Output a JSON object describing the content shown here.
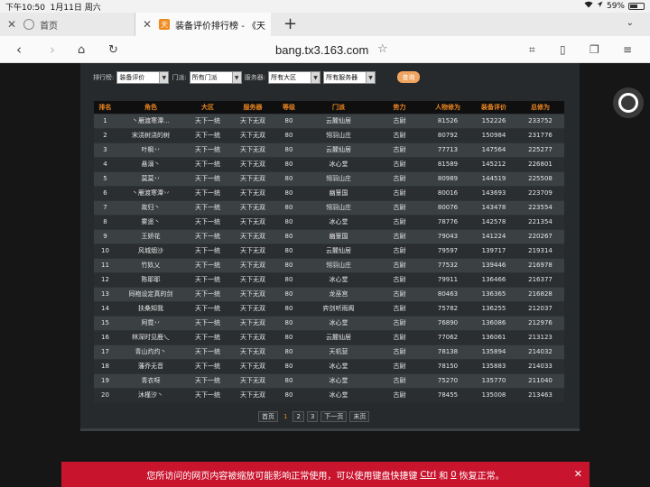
{
  "status": {
    "time": "下午10:50",
    "date": "1月11日 周六",
    "battery": "59%",
    "battery_level": 0.59,
    "icons": [
      "wifi-icon",
      "location-icon",
      "battery-icon"
    ]
  },
  "tabs": [
    {
      "title": "首页"
    },
    {
      "title": "装备评价排行榜 - 《天"
    }
  ],
  "toolbar": {
    "url": "bang.tx3.163.com"
  },
  "filters": {
    "rank_label": "排行榜:",
    "rank_value": "装备评价",
    "school_label": "门派:",
    "school_value": "所有门派",
    "server_label": "服务器:",
    "zone_value": "所有大区",
    "server_value": "所有服务器",
    "query_label": "查询"
  },
  "table": {
    "headers": [
      "排名",
      "角色",
      "大区",
      "服务器",
      "等级",
      "门派",
      "势力",
      "人物修为",
      "装备评价",
      "总修为"
    ],
    "rows": [
      [
        "1",
        "丶雁渡寒潭...",
        "天下一统",
        "天下无双",
        "80",
        "云麓仙居",
        "古尉",
        "81526",
        "152226",
        "233752"
      ],
      [
        "2",
        "宋浇树浇的树",
        "天下一统",
        "天下无双",
        "80",
        "翎羽山庄",
        "古尉",
        "80792",
        "150984",
        "231776"
      ],
      [
        "3",
        "叶枫丷",
        "天下一统",
        "天下无双",
        "80",
        "云麓仙居",
        "古尉",
        "77713",
        "147564",
        "225277"
      ],
      [
        "4",
        "悬溺丶",
        "天下一统",
        "天下无双",
        "80",
        "冰心堂",
        "古尉",
        "81589",
        "145212",
        "226801"
      ],
      [
        "5",
        "莫莫丷",
        "天下一统",
        "天下无双",
        "80",
        "翎羽山庄",
        "古尉",
        "80989",
        "144519",
        "225508"
      ],
      [
        "6",
        "丶雁渡寒潭丷",
        "天下一统",
        "天下无双",
        "80",
        "幽篁国",
        "古尉",
        "80016",
        "143693",
        "223709"
      ],
      [
        "7",
        "故归丶",
        "天下一统",
        "天下无双",
        "80",
        "翎羽山庄",
        "古尉",
        "80076",
        "143478",
        "223554"
      ],
      [
        "8",
        "雾遥丶",
        "天下一统",
        "天下无双",
        "80",
        "冰心堂",
        "古尉",
        "78776",
        "142578",
        "221354"
      ],
      [
        "9",
        "王娇花",
        "天下一统",
        "天下无双",
        "80",
        "幽篁国",
        "古尉",
        "79043",
        "141224",
        "220267"
      ],
      [
        "10",
        "风城烟沙",
        "天下一统",
        "天下无双",
        "80",
        "云麓仙居",
        "古尉",
        "79597",
        "139717",
        "219314"
      ],
      [
        "11",
        "竹奺乂",
        "天下一统",
        "天下无双",
        "80",
        "翎羽山庄",
        "古尉",
        "77532",
        "139446",
        "216978"
      ],
      [
        "12",
        "陈耶耶",
        "天下一统",
        "天下无双",
        "80",
        "冰心堂",
        "古尉",
        "79911",
        "136466",
        "216377"
      ],
      [
        "13",
        "同袍设定真的剑",
        "天下一统",
        "天下无双",
        "80",
        "龙巫宫",
        "古尉",
        "80463",
        "136365",
        "216828"
      ],
      [
        "14",
        "扶桑知我",
        "天下一统",
        "天下无双",
        "80",
        "弈剑听雨阁",
        "古尉",
        "75782",
        "136255",
        "212037"
      ],
      [
        "15",
        "阿霓丷",
        "天下一统",
        "天下无双",
        "80",
        "冰心堂",
        "古尉",
        "76890",
        "136086",
        "212976"
      ],
      [
        "16",
        "林深时见鹿乀",
        "天下一统",
        "天下无双",
        "80",
        "云麓仙居",
        "古尉",
        "77062",
        "136061",
        "213123"
      ],
      [
        "17",
        "青山灼灼丶",
        "天下一统",
        "天下无双",
        "80",
        "天机营",
        "古尉",
        "78138",
        "135894",
        "214032"
      ],
      [
        "18",
        "藩乔无音",
        "天下一统",
        "天下无双",
        "80",
        "冰心堂",
        "古尉",
        "78150",
        "135883",
        "214033"
      ],
      [
        "19",
        "青衣呀",
        "天下一统",
        "天下无双",
        "80",
        "冰心堂",
        "古尉",
        "75270",
        "135770",
        "211040"
      ],
      [
        "20",
        "沐槿汐丶",
        "天下一统",
        "天下无双",
        "80",
        "冰心堂",
        "古尉",
        "78455",
        "135008",
        "213463"
      ]
    ]
  },
  "pager": {
    "first": "首页",
    "pages": [
      "1",
      "2",
      "3"
    ],
    "next": "下一页",
    "last": "末页"
  },
  "notice": {
    "pre": "您所访问的网页内容被缩放可能影响正常使用，可以使用键盘快捷键",
    "key1": "Ctrl",
    "and": "和",
    "key2": "0",
    "post": "恢复正常。"
  }
}
